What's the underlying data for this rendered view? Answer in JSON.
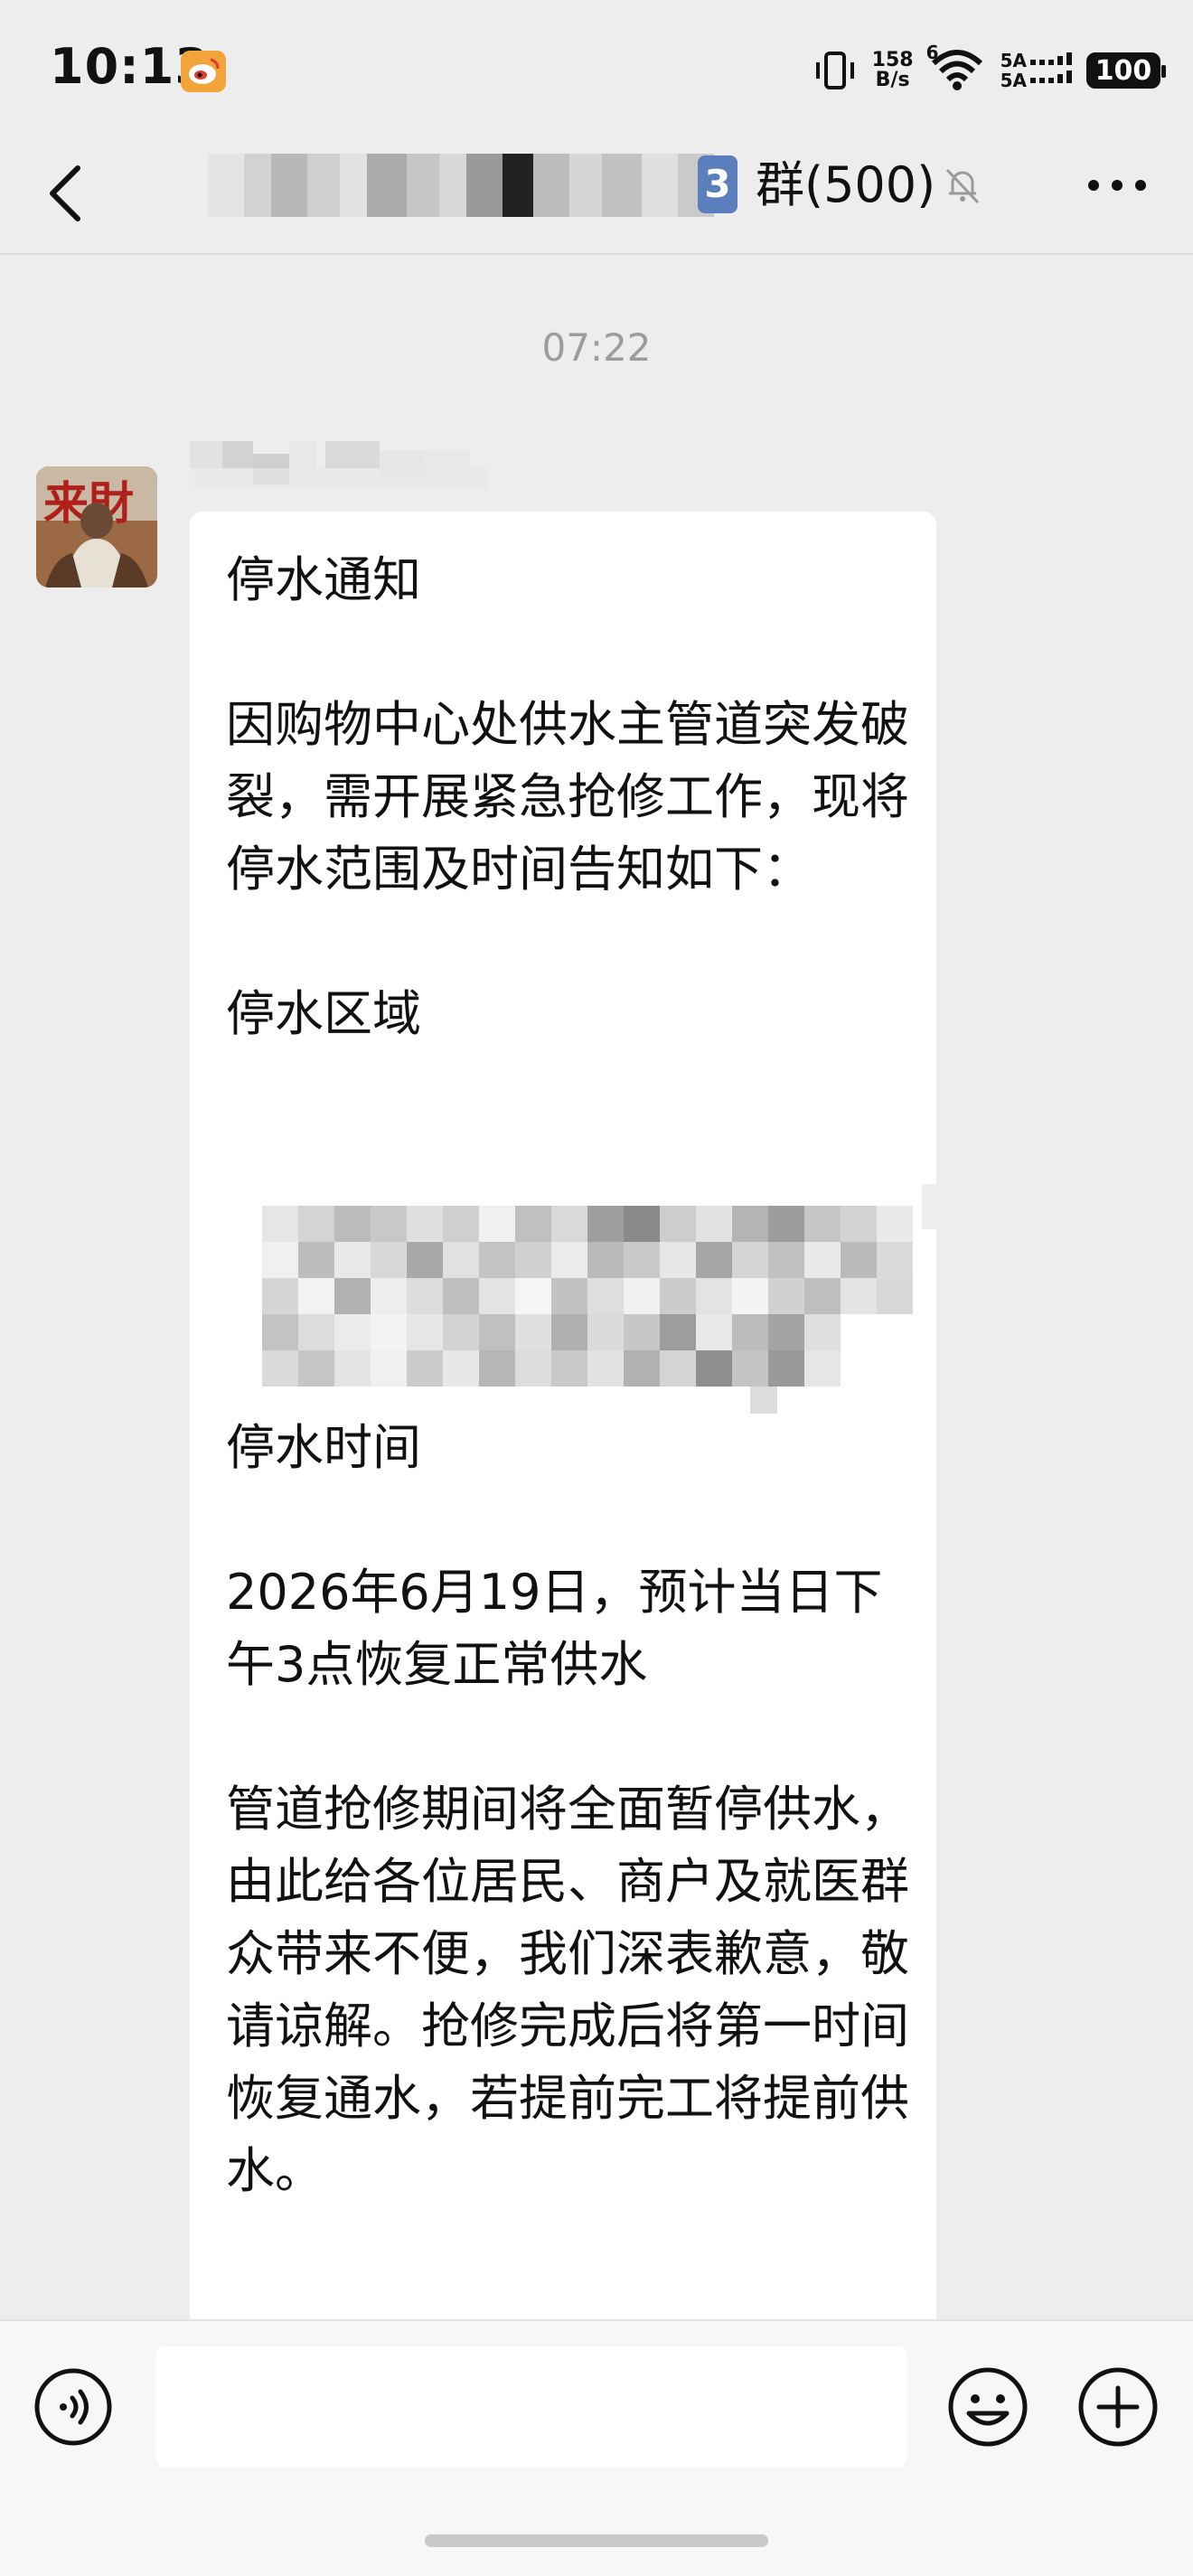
{
  "status_bar": {
    "time": "10:13",
    "net_speed_value": "158",
    "net_speed_unit": "B/s",
    "wifi_label": "6",
    "sim1_label": "5A",
    "sim2_label": "5A",
    "battery": "100"
  },
  "header": {
    "badge": "3",
    "title": "群(500)"
  },
  "chat": {
    "time_divider": "07:22",
    "message_text": "停水通知\n\n因购物中心处供水主管道突发破裂，需开展紧急抢修工作，现将停水范围及时间告知如下：\n\n停水区域\n\n\n\n\n\n停水时间\n\n2026年6月19日，预计当日下午3点恢复正常供水\n\n管道抢修期间将全面暂停供水，由此给各位居民、商户及就医群众带来不便，我们深表歉意，敬请谅解。抢修完成后将第一时间恢复通水，若提前完工将提前供水。"
  },
  "icons": {
    "back": "chevron-left-icon",
    "mute": "bell-off-icon",
    "more": "more-dots-icon",
    "voice": "voice-icon",
    "emoji": "emoji-icon",
    "plus": "plus-icon"
  }
}
